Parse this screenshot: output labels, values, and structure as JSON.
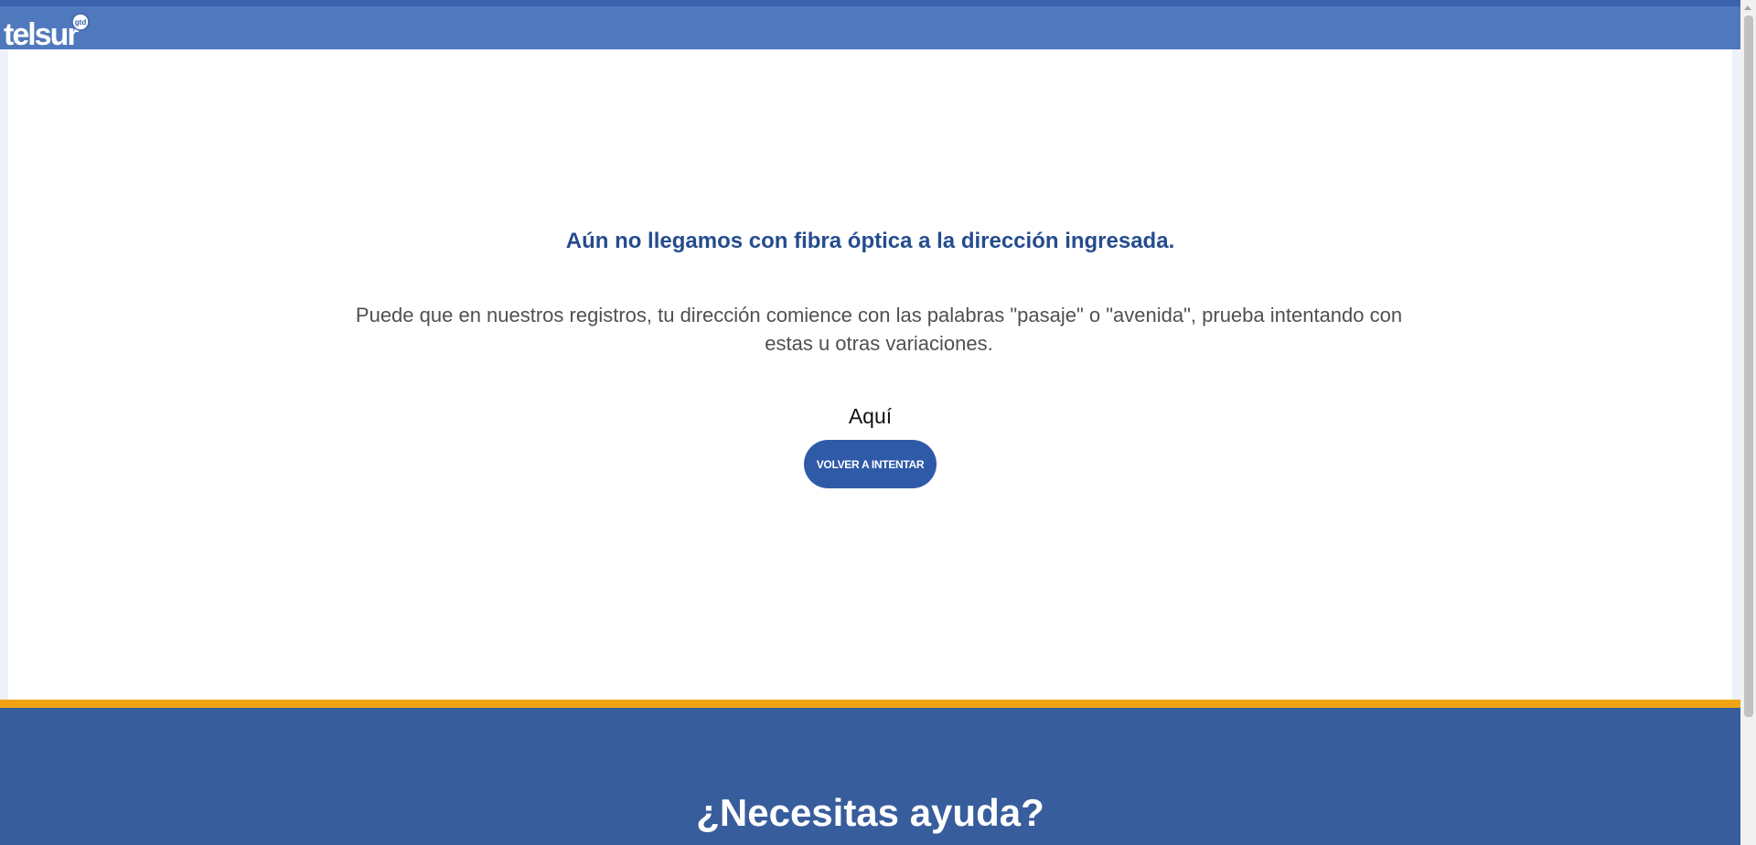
{
  "header": {
    "logo_text": "telsur",
    "logo_badge": "gtd"
  },
  "main": {
    "heading": "Aún no llegamos con fibra óptica a la dirección ingresada.",
    "message": "Puede que en nuestros registros, tu dirección comience con las palabras \"pasaje\" o \"avenida\", prueba intentando con estas u otras variaciones.",
    "link_text": "Aquí",
    "retry_button_label": "VOLVER A INTENTAR"
  },
  "footer": {
    "heading": "¿Necesitas ayuda?"
  },
  "colors": {
    "header": "#5078bd",
    "heading": "#254c8e",
    "button": "#2f5aa8",
    "accent_line": "#f0a414",
    "footer": "#385d9c"
  }
}
